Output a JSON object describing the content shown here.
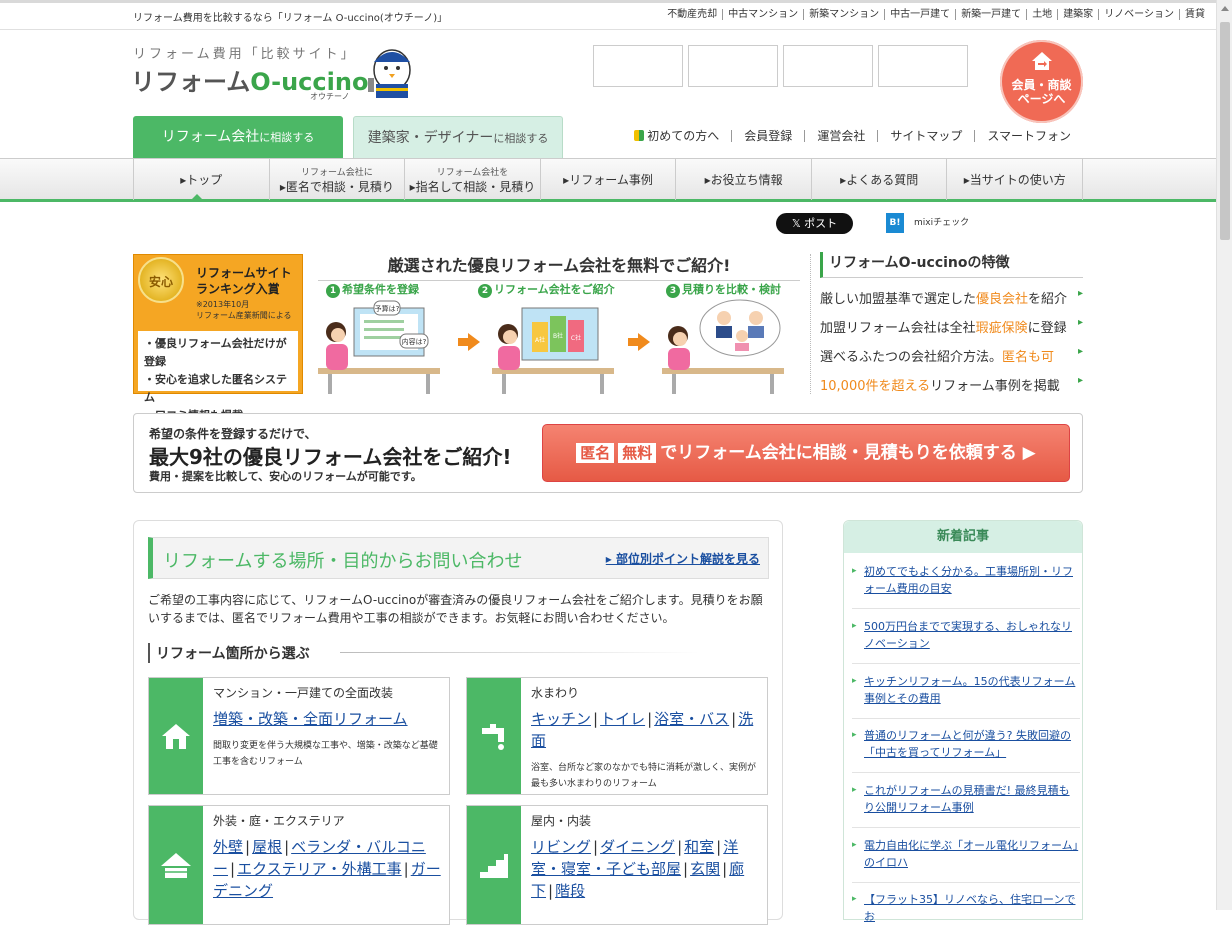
{
  "topbar": {
    "tagline": "リフォーム費用を比較するなら「リフォーム O-uccino(オウチーノ)」",
    "links": [
      "不動産売却",
      "中古マンション",
      "新築マンション",
      "中古一戸建て",
      "新築一戸建て",
      "土地",
      "建築家",
      "リノベーション",
      "賃貸"
    ]
  },
  "logo": {
    "subtitle": "リフォーム費用「比較サイト」",
    "main_prefix": "リフォーム",
    "main_brand": "O-uccino",
    "small": "オウチーノ"
  },
  "member_button": {
    "line1": "会員・商談",
    "line2": "ページへ"
  },
  "tabs": [
    {
      "main": "リフォーム会社",
      "suffix": "に相談する"
    },
    {
      "main": "建築家・デザイナー",
      "suffix": "に相談する"
    }
  ],
  "sublinks": [
    "初めての方へ",
    "会員登録",
    "運営会社",
    "サイトマップ",
    "スマートフォン"
  ],
  "gnav": [
    {
      "small": "",
      "label": "トップ"
    },
    {
      "small": "リフォーム会社に",
      "label": "匿名で相談・見積り"
    },
    {
      "small": "リフォーム会社を",
      "label": "指名して相談・見積り"
    },
    {
      "small": "",
      "label": "リフォーム事例"
    },
    {
      "small": "",
      "label": "お役立ち情報"
    },
    {
      "small": "",
      "label": "よくある質問"
    },
    {
      "small": "",
      "label": "当サイトの使い方"
    }
  ],
  "social": {
    "post": "ポスト",
    "hatena": "B!",
    "mixi": "mixiチェック"
  },
  "rank_box": {
    "medal": "安心",
    "title1": "リフォームサイト",
    "title2": "ランキング入賞",
    "note1": "※2013年10月",
    "note2": "リフォーム産業新聞による",
    "items": [
      "・優良リフォーム会社だけが登録",
      "・安心を追求した匿名システム",
      "・口コミ情報も掲載"
    ]
  },
  "intro_banner": {
    "title": "厳選された優良リフォーム会社を無料でご紹介!",
    "steps": [
      {
        "num": "1",
        "label": "希望条件を登録"
      },
      {
        "num": "2",
        "label": "リフォーム会社をご紹介"
      },
      {
        "num": "3",
        "label": "見積りを比較・検討"
      }
    ],
    "bubbles": {
      "q1": "予算は?",
      "q2": "内容は?",
      "a": "A社",
      "b": "B社",
      "c": "C社"
    }
  },
  "features": {
    "title": "リフォームO-uccinoの特徴",
    "items": [
      {
        "pre": "厳しい加盟基準で選定した",
        "hl": "優良会社",
        "post": "を紹介"
      },
      {
        "pre": "加盟リフォーム会社は全社",
        "hl": "瑕疵保険",
        "post": "に登録"
      },
      {
        "pre": "選べるふたつの会社紹介方法。",
        "hl": "匿名も可",
        "post": ""
      },
      {
        "pre": "",
        "hl": "10,000件を超える",
        "post": "リフォーム事例を掲載"
      }
    ]
  },
  "cta": {
    "line1": "希望の条件を登録するだけで、",
    "line2": "最大9社の優良リフォーム会社をご紹介!",
    "line3": "費用・提案を比較して、安心のリフォームが可能です。",
    "tag1": "匿名",
    "tag2": "無料",
    "button": "でリフォーム会社に相談・見積もりを依頼する ▶"
  },
  "main": {
    "section_title": "リフォームする場所・目的からお問い合わせ",
    "section_link": "部位別ポイント解説を見る",
    "intro": "ご希望の工事内容に応じて、リフォームO-uccinoが審査済みの優良リフォーム会社をご紹介します。見積りをお願いするまでは、匿名でリフォーム費用や工事の相談ができます。お気軽にお問い合わせください。",
    "subheading": "リフォーム箇所から選ぶ",
    "cards": [
      {
        "category": "マンション・一戸建ての全面改装",
        "links": [
          "増築・改築・全面リフォーム"
        ],
        "desc": "間取り変更を伴う大規模な工事や、増築・改築など基礎工事を含むリフォーム",
        "icon": "house-icon"
      },
      {
        "category": "水まわり",
        "links": [
          "キッチン",
          "トイレ",
          "浴室・バス",
          "洗面"
        ],
        "desc": "浴室、台所など家のなかでも特に消耗が激しく、実例が最も多い水まわりのリフォーム",
        "icon": "faucet-icon"
      },
      {
        "category": "外装・庭・エクステリア",
        "links": [
          "外壁",
          "屋根",
          "ベランダ・バルコニー",
          "エクステリア・外構工事",
          "ガーデニング"
        ],
        "desc": "",
        "icon": "roof-icon"
      },
      {
        "category": "屋内・内装",
        "links": [
          "リビング",
          "ダイニング",
          "和室",
          "洋室・寝室・子ども部屋",
          "玄関",
          "廊下",
          "階段"
        ],
        "desc": "",
        "icon": "stairs-icon"
      }
    ]
  },
  "sidebar": {
    "title": "新着記事",
    "articles": [
      "初めてでもよく分かる。工事場所別・リフォーム費用の目安",
      "500万円台までで実現する、おしゃれなリノベーション",
      "キッチンリフォーム。15の代表リフォーム事例とその費用",
      "普通のリフォームと何が違う? 失敗回避の「中古を買ってリフォーム」",
      "これがリフォームの見積書だ! 最終見積もり公開リフォーム事例",
      "電力自由化に学ぶ「オール電化リフォーム」のイロハ",
      "【フラット35】リノベなら、住宅ローンでお"
    ]
  },
  "colors": {
    "green": "#4cb866",
    "orange": "#f08a1c",
    "red": "#e65a45",
    "link": "#1a4fa0"
  }
}
